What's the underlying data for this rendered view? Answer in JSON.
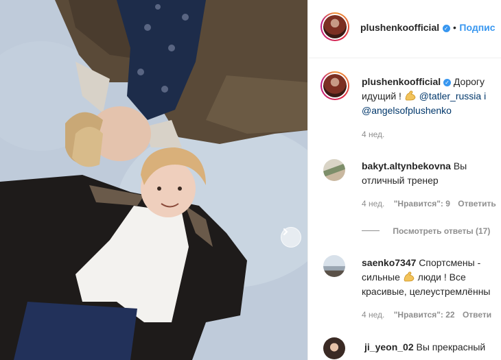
{
  "post": {
    "author": "plushenkoofficial",
    "follow_label": "Подпис",
    "caption_text": "Дорогу",
    "caption_line2": "идущий !",
    "mention1": "@tatler_russia",
    "mention1_tail": "i",
    "mention2": "@angelsofplushenko",
    "age": "4 нед."
  },
  "comments": [
    {
      "user": "bakyt.altynbekovna",
      "text_head": "Вы",
      "text_line2": "отличный тренер",
      "age": "4 нед.",
      "likes_label": "\"Нравится\": 9",
      "reply_label": "Ответить",
      "view_replies": "Посмотреть ответы (17)"
    },
    {
      "user": "saenko7347",
      "text_head": "Спортсмены -",
      "text_line2a": "сильные",
      "text_line2b": "люди ! Все",
      "text_line3": "красивые, целеустремлённы",
      "age": "4 нед.",
      "likes_label": "\"Нравится\": 22",
      "reply_label": "Ответи"
    },
    {
      "user": "ji_yeon_02",
      "text_head": "Вы прекрасный"
    }
  ],
  "icons": {
    "verified": "verified-badge-icon",
    "next": "chevron-right-icon",
    "emoji": "flexed-biceps-icon"
  },
  "colors": {
    "link": "#00376b",
    "follow": "#3897f0",
    "muted": "#8e8e8e",
    "text": "#262626"
  }
}
